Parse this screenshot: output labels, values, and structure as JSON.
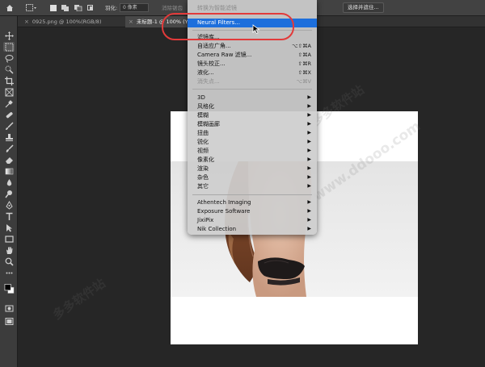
{
  "options_bar": {
    "feather_label": "羽化:",
    "feather_value": "0 像素",
    "antialias_label": "消除锯齿",
    "select_mask_button": "选择并遮住..."
  },
  "tabs": [
    {
      "label": "0925.png @ 100%(RGB/8)",
      "active": false
    },
    {
      "label": "未标题-1 @ 100% (Y42, RGB",
      "active": true
    }
  ],
  "toolbar": {
    "tools": [
      "move-tool",
      "marquee-tool",
      "lasso-tool",
      "quick-select-tool",
      "crop-tool",
      "frame-tool",
      "eyedropper-tool",
      "healing-brush-tool",
      "brush-tool",
      "clone-stamp-tool",
      "history-brush-tool",
      "eraser-tool",
      "gradient-tool",
      "blur-tool",
      "dodge-tool",
      "pen-tool",
      "type-tool",
      "path-select-tool",
      "rectangle-tool",
      "hand-tool",
      "zoom-tool"
    ]
  },
  "menu": {
    "top_item": "转换为智能滤镜",
    "neural_filters": "Neural Filters...",
    "group1": [
      {
        "label": "滤镜库...",
        "shortcut": "",
        "disabled": false
      },
      {
        "label": "自适应广角...",
        "shortcut": "⌥⇧⌘A",
        "disabled": false
      },
      {
        "label": "Camera Raw 滤镜...",
        "shortcut": "⇧⌘A",
        "disabled": false
      },
      {
        "label": "镜头校正...",
        "shortcut": "⇧⌘R",
        "disabled": false
      },
      {
        "label": "液化...",
        "shortcut": "⇧⌘X",
        "disabled": false
      },
      {
        "label": "消失点...",
        "shortcut": "⌥⌘V",
        "disabled": true
      }
    ],
    "group2": [
      "3D",
      "风格化",
      "模糊",
      "模糊画廊",
      "扭曲",
      "锐化",
      "视频",
      "像素化",
      "渲染",
      "杂色",
      "其它"
    ],
    "group3": [
      "Athentech Imaging",
      "Exposure Software",
      "JixiPix",
      "Nik Collection"
    ],
    "arrow_glyph": "▶"
  },
  "watermark": {
    "text_cn": "多多软件站",
    "text_en": "www.ddooo.com"
  }
}
